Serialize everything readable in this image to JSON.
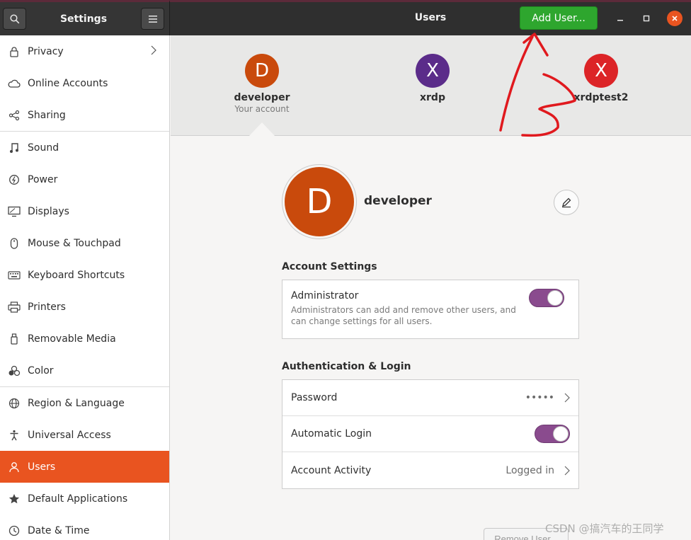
{
  "header": {
    "settings_title": "Settings",
    "page_title": "Users",
    "add_user_label": "Add User..."
  },
  "sidebar": {
    "items": [
      {
        "label": "Privacy",
        "icon": "lock-icon"
      },
      {
        "label": "Online Accounts",
        "icon": "cloud-icon"
      },
      {
        "label": "Sharing",
        "icon": "share-icon"
      },
      {
        "label": "Sound",
        "icon": "music-note-icon"
      },
      {
        "label": "Power",
        "icon": "power-icon"
      },
      {
        "label": "Displays",
        "icon": "display-icon"
      },
      {
        "label": "Mouse & Touchpad",
        "icon": "mouse-icon"
      },
      {
        "label": "Keyboard Shortcuts",
        "icon": "keyboard-icon"
      },
      {
        "label": "Printers",
        "icon": "printer-icon"
      },
      {
        "label": "Removable Media",
        "icon": "usb-icon"
      },
      {
        "label": "Color",
        "icon": "color-icon"
      },
      {
        "label": "Region & Language",
        "icon": "globe-icon"
      },
      {
        "label": "Universal Access",
        "icon": "accessibility-icon"
      },
      {
        "label": "Users",
        "icon": "users-icon"
      },
      {
        "label": "Default Applications",
        "icon": "star-icon"
      },
      {
        "label": "Date & Time",
        "icon": "clock-icon"
      }
    ],
    "active": "Users"
  },
  "users": [
    {
      "initial": "D",
      "name": "developer",
      "subtitle": "Your account",
      "color": "#c94a0c"
    },
    {
      "initial": "X",
      "name": "xrdp",
      "subtitle": "",
      "color": "#5b2c8a"
    },
    {
      "initial": "X",
      "name": "xrdptest2",
      "subtitle": "",
      "color": "#dc2427"
    }
  ],
  "selected_user": {
    "initial": "D",
    "name": "developer"
  },
  "account_settings": {
    "title": "Account Settings",
    "admin_label": "Administrator",
    "admin_desc": "Administrators can add and remove other users, and can change settings for all users.",
    "admin_enabled": true
  },
  "auth": {
    "title": "Authentication & Login",
    "password_label": "Password",
    "password_value": "•••••",
    "auto_login_label": "Automatic Login",
    "auto_login_enabled": true,
    "activity_label": "Account Activity",
    "activity_value": "Logged in"
  },
  "remove_user_label": "Remove User...",
  "watermark": "CSDN @搞汽车的王同学",
  "colors": {
    "accent": "#e95420",
    "add_user_green": "#2ea62e",
    "toggle_purple": "#8a4b8e",
    "annotation_red": "#e0191e"
  }
}
